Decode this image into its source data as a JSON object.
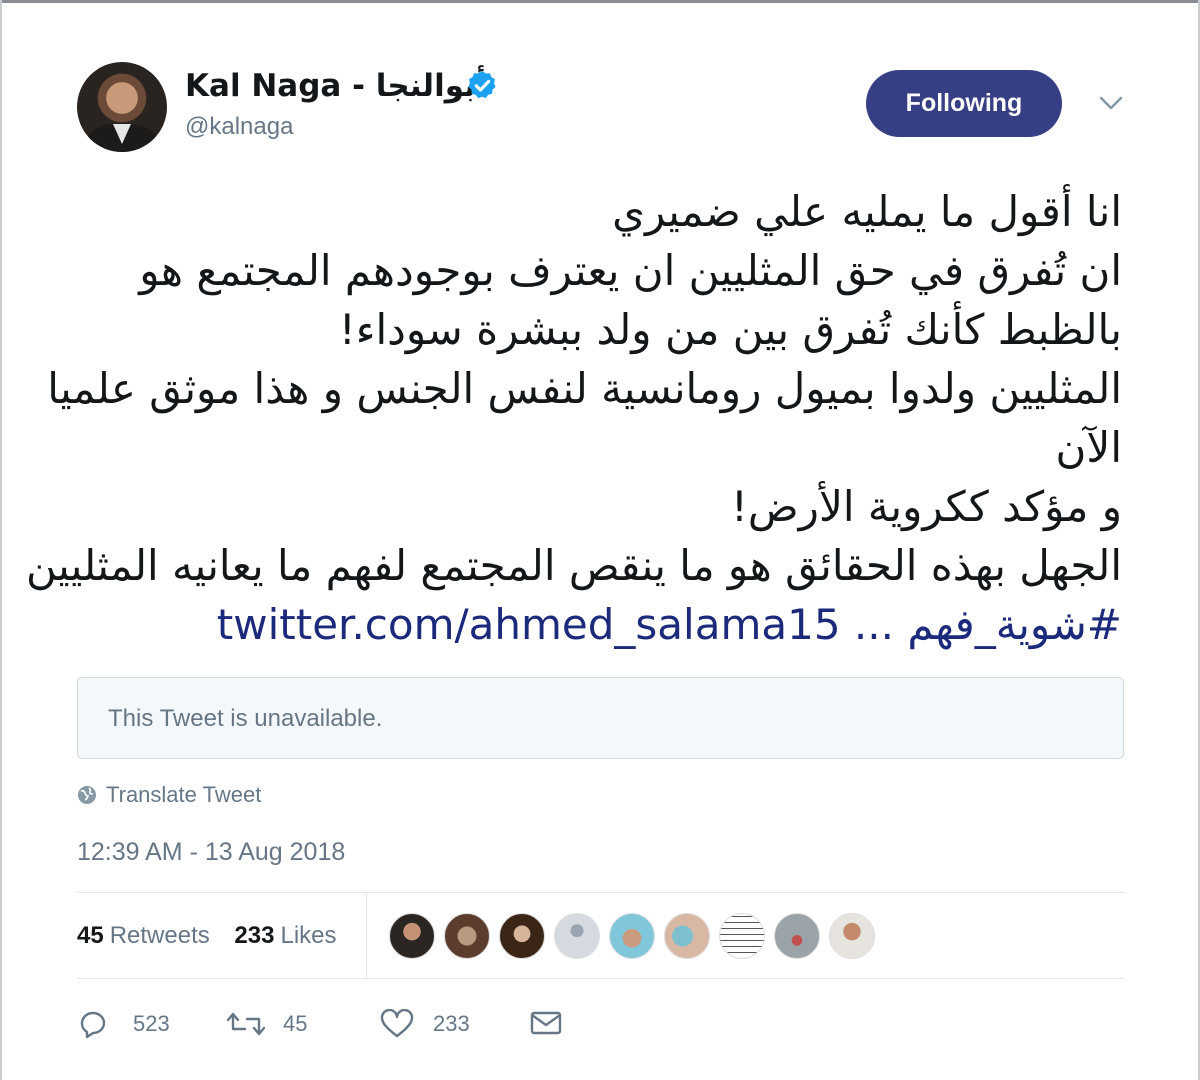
{
  "author": {
    "name": "Kal Naga - أبوالنجا",
    "handle": "@kalnaga",
    "verified_color": "#1da1f2",
    "avatar_icon": "profile-photo"
  },
  "follow_button": {
    "label": "Following",
    "color": "#363f83"
  },
  "menu_icon": "chevron-down-icon",
  "tweet": {
    "lines": [
      "انا أقول ما يمليه علي ضميري",
      "ان تُفرق في حق المثليين ان يعترف بوجودهم المجتمع هو",
      "بالظبط كأنك تُفرق بين من ولد ببشرة سوداء!",
      "المثليين ولدوا بميول رومانسية لنفس الجنس و هذا موثق علميا",
      "الآن",
      "و مؤكد ككروية الأرض!",
      "الجهل بهذه الحقائق هو ما ينقص المجتمع لفهم ما يعانيه المثليين"
    ],
    "hashtag": "#شوية_فهم",
    "link": "twitter.com/ahmed_salama15 ..."
  },
  "quoted_tweet": {
    "text": "This Tweet is unavailable."
  },
  "translate_label": "Translate Tweet",
  "timestamp": "12:39 AM - 13 Aug 2018",
  "stats": {
    "retweets_count": "45",
    "retweets_label": "Retweets",
    "likes_count": "233",
    "likes_label": "Likes"
  },
  "likers_count": 9,
  "actions": {
    "replies": "523",
    "retweets": "45",
    "likes": "233"
  }
}
